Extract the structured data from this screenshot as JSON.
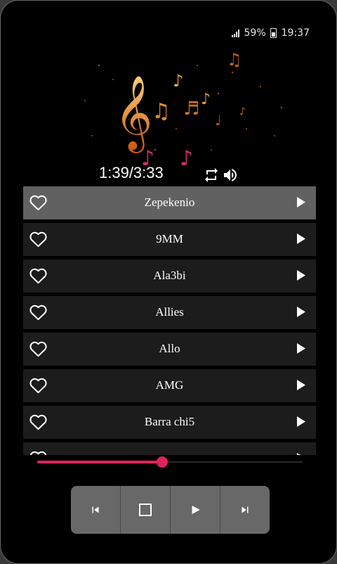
{
  "status_bar": {
    "battery": "59%",
    "clock": "19:37"
  },
  "player": {
    "time_display": "1:39/3:33",
    "progress": 0.47
  },
  "tracks": [
    {
      "title": "Zepekenio",
      "active": true
    },
    {
      "title": "9MM"
    },
    {
      "title": "Ala3bi"
    },
    {
      "title": "Allies"
    },
    {
      "title": "Allo"
    },
    {
      "title": "AMG"
    },
    {
      "title": "Barra chi5"
    },
    {
      "title": ""
    }
  ],
  "colors": {
    "accent": "#e3215a",
    "active_row": "#616161",
    "row": "#1c1c1c"
  },
  "icons": {
    "repeat": "repeat-icon",
    "volume": "volume-icon",
    "previous": "skip-previous-icon",
    "stop": "stop-icon",
    "play": "play-icon",
    "next": "skip-next-icon",
    "favorite": "heart-outline-icon"
  }
}
